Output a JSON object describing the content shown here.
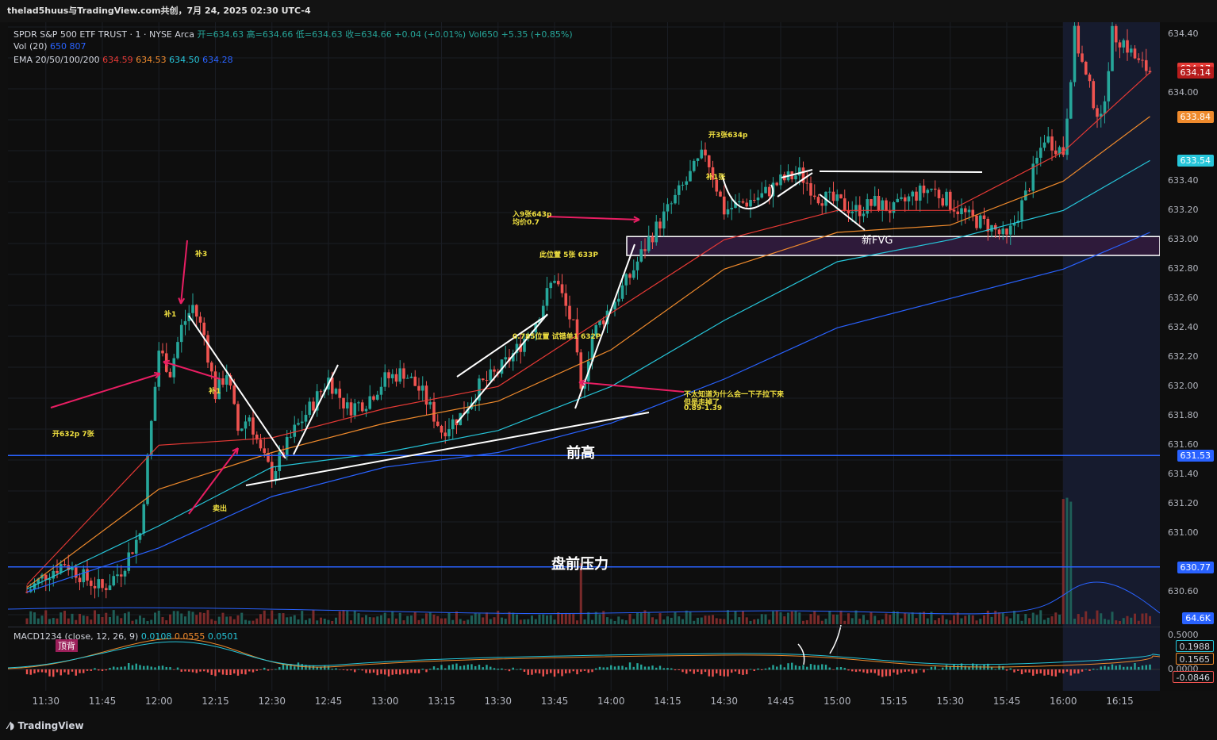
{
  "header": {
    "title": "thelad5huus与TradingView.com共创，7月 24, 2025 02:30 UTC-4"
  },
  "legend": {
    "symbol": "SPDR S&P 500 ETF TRUST · 1 · NYSE Arca",
    "ohlc": "开=634.63  高=634.66  低=634.63  收=634.66  +0.04 (+0.01%)  Vol650  +5.35 (+0.85%)",
    "vol": "Vol (20)",
    "vol_vals": "650  807",
    "ema": "EMA 20/50/100/200",
    "ema_vals": [
      "634.59",
      "634.53",
      "634.50",
      "634.28"
    ],
    "macd": "MACD1234 (close, 12, 26, 9)",
    "macd_vals": [
      "0.0108",
      "0.0555",
      "0.0501"
    ],
    "macd_badge": "顶背"
  },
  "colors": {
    "ema20": "#e53935",
    "ema50": "#ef8a2c",
    "ema100": "#26c6da",
    "ema200": "#2962ff",
    "up": "#26a69a",
    "down": "#ef5350",
    "hline": "#2962ff"
  },
  "y_ticks": [
    "634.40",
    "634.00",
    "633.40",
    "633.20",
    "633.00",
    "632.80",
    "632.60",
    "632.40",
    "632.20",
    "632.00",
    "631.80",
    "631.60",
    "631.40",
    "631.20",
    "631.00",
    "630.60"
  ],
  "y_badges": [
    {
      "text": "634.17",
      "color": "#e53935"
    },
    {
      "text": "634.14",
      "color": "#b71c1c"
    },
    {
      "text": "633.84",
      "color": "#ef8a2c"
    },
    {
      "text": "633.54",
      "color": "#26c6da"
    },
    {
      "text": "631.53",
      "color": "#2962ff"
    },
    {
      "text": "630.77",
      "color": "#2962ff"
    },
    {
      "text": "64.6K",
      "color": "#2962ff"
    }
  ],
  "macd_ticks": [
    "0.5000",
    "0.1988",
    "0.1565",
    "0.0000",
    "-0.0846"
  ],
  "x_ticks": [
    "11:30",
    "11:45",
    "12:00",
    "12:15",
    "12:30",
    "12:45",
    "13:00",
    "13:15",
    "13:30",
    "13:45",
    "14:00",
    "14:15",
    "14:30",
    "14:45",
    "15:00",
    "15:15",
    "15:30",
    "15:45",
    "16:00",
    "16:15"
  ],
  "annotations": {
    "open632": "开632p 7张",
    "bu3": "补3",
    "bu_a": "补1",
    "bu_b": "补1",
    "sell": "卖出",
    "add9": "入9张643p",
    "avg": "均价0.7",
    "here5": "此位置 5张 633P",
    "fib": "0.785位置 试错单1 632P",
    "why1": "不太知道为什么会一下子拉下来",
    "why2": "但是走掉了",
    "why3": "0.89-1.39",
    "open3": "开3张634p",
    "bu_c": "补1张",
    "fvg": "新FVG",
    "prevhigh": "前高",
    "premarket": "盘前压力"
  },
  "chart_data": {
    "type": "candlestick",
    "symbol": "SPY",
    "timeframe": "1m",
    "x_range": [
      "11:25",
      "16:25"
    ],
    "ylim": [
      630.45,
      634.45
    ],
    "hlines": [
      631.53,
      630.77
    ],
    "fvg_zone": [
      632.92,
      633.0
    ],
    "close_path": [
      [
        "11:25",
        630.6
      ],
      [
        "11:30",
        630.72
      ],
      [
        "11:35",
        630.8
      ],
      [
        "11:40",
        630.7
      ],
      [
        "11:45",
        630.62
      ],
      [
        "11:50",
        630.75
      ],
      [
        "11:55",
        631.0
      ],
      [
        "12:00",
        632.25
      ],
      [
        "12:03",
        632.1
      ],
      [
        "12:06",
        632.4
      ],
      [
        "12:09",
        632.55
      ],
      [
        "12:12",
        632.35
      ],
      [
        "12:15",
        631.95
      ],
      [
        "12:18",
        632.1
      ],
      [
        "12:21",
        631.7
      ],
      [
        "12:24",
        631.8
      ],
      [
        "12:27",
        631.55
      ],
      [
        "12:30",
        631.4
      ],
      [
        "12:33",
        631.55
      ],
      [
        "12:36",
        631.7
      ],
      [
        "12:40",
        631.85
      ],
      [
        "12:45",
        632.05
      ],
      [
        "12:50",
        631.85
      ],
      [
        "12:55",
        631.9
      ],
      [
        "13:00",
        632.05
      ],
      [
        "13:05",
        632.1
      ],
      [
        "13:10",
        631.95
      ],
      [
        "13:15",
        631.7
      ],
      [
        "13:20",
        631.8
      ],
      [
        "13:25",
        632.0
      ],
      [
        "13:30",
        632.1
      ],
      [
        "13:35",
        632.25
      ],
      [
        "13:40",
        632.45
      ],
      [
        "13:45",
        632.75
      ],
      [
        "13:50",
        632.4
      ],
      [
        "13:52",
        631.95
      ],
      [
        "13:55",
        632.35
      ],
      [
        "14:00",
        632.55
      ],
      [
        "14:05",
        632.75
      ],
      [
        "14:10",
        633.0
      ],
      [
        "14:15",
        633.2
      ],
      [
        "14:20",
        633.4
      ],
      [
        "14:25",
        633.6
      ],
      [
        "14:30",
        633.2
      ],
      [
        "14:35",
        633.25
      ],
      [
        "14:40",
        633.3
      ],
      [
        "14:45",
        633.4
      ],
      [
        "14:50",
        633.45
      ],
      [
        "14:55",
        633.3
      ],
      [
        "15:00",
        633.25
      ],
      [
        "15:05",
        633.2
      ],
      [
        "15:10",
        633.25
      ],
      [
        "15:15",
        633.2
      ],
      [
        "15:20",
        633.3
      ],
      [
        "15:25",
        633.35
      ],
      [
        "15:30",
        633.25
      ],
      [
        "15:35",
        633.15
      ],
      [
        "15:40",
        633.1
      ],
      [
        "15:45",
        633.0
      ],
      [
        "15:50",
        633.3
      ],
      [
        "15:55",
        633.7
      ],
      [
        "16:00",
        633.6
      ],
      [
        "16:03",
        634.4
      ],
      [
        "16:06",
        634.1
      ],
      [
        "16:10",
        633.8
      ],
      [
        "16:13",
        634.4
      ],
      [
        "16:16",
        634.35
      ],
      [
        "16:20",
        634.2
      ],
      [
        "16:23",
        634.15
      ]
    ],
    "ema": {
      "ema20": [
        [
          "11:25",
          630.65
        ],
        [
          "12:00",
          631.6
        ],
        [
          "12:30",
          631.65
        ],
        [
          "13:00",
          631.85
        ],
        [
          "13:30",
          632.0
        ],
        [
          "14:00",
          632.5
        ],
        [
          "14:30",
          633.0
        ],
        [
          "15:00",
          633.2
        ],
        [
          "15:30",
          633.2
        ],
        [
          "16:00",
          633.6
        ],
        [
          "16:23",
          634.14
        ]
      ],
      "ema50": [
        [
          "11:25",
          630.63
        ],
        [
          "12:00",
          631.3
        ],
        [
          "12:30",
          631.55
        ],
        [
          "13:00",
          631.75
        ],
        [
          "13:30",
          631.9
        ],
        [
          "14:00",
          632.25
        ],
        [
          "14:30",
          632.8
        ],
        [
          "15:00",
          633.05
        ],
        [
          "15:30",
          633.1
        ],
        [
          "16:00",
          633.4
        ],
        [
          "16:23",
          633.84
        ]
      ],
      "ema100": [
        [
          "11:25",
          630.62
        ],
        [
          "12:00",
          631.05
        ],
        [
          "12:30",
          631.45
        ],
        [
          "13:00",
          631.55
        ],
        [
          "13:30",
          631.7
        ],
        [
          "14:00",
          632.0
        ],
        [
          "14:30",
          632.45
        ],
        [
          "15:00",
          632.85
        ],
        [
          "15:30",
          633.0
        ],
        [
          "16:00",
          633.2
        ],
        [
          "16:23",
          633.54
        ]
      ],
      "ema200": [
        [
          "11:25",
          630.6
        ],
        [
          "12:00",
          630.9
        ],
        [
          "12:30",
          631.25
        ],
        [
          "13:00",
          631.45
        ],
        [
          "13:30",
          631.55
        ],
        [
          "14:00",
          631.75
        ],
        [
          "14:30",
          632.05
        ],
        [
          "15:00",
          632.4
        ],
        [
          "15:30",
          632.6
        ],
        [
          "16:00",
          632.8
        ],
        [
          "16:23",
          633.05
        ]
      ]
    }
  }
}
